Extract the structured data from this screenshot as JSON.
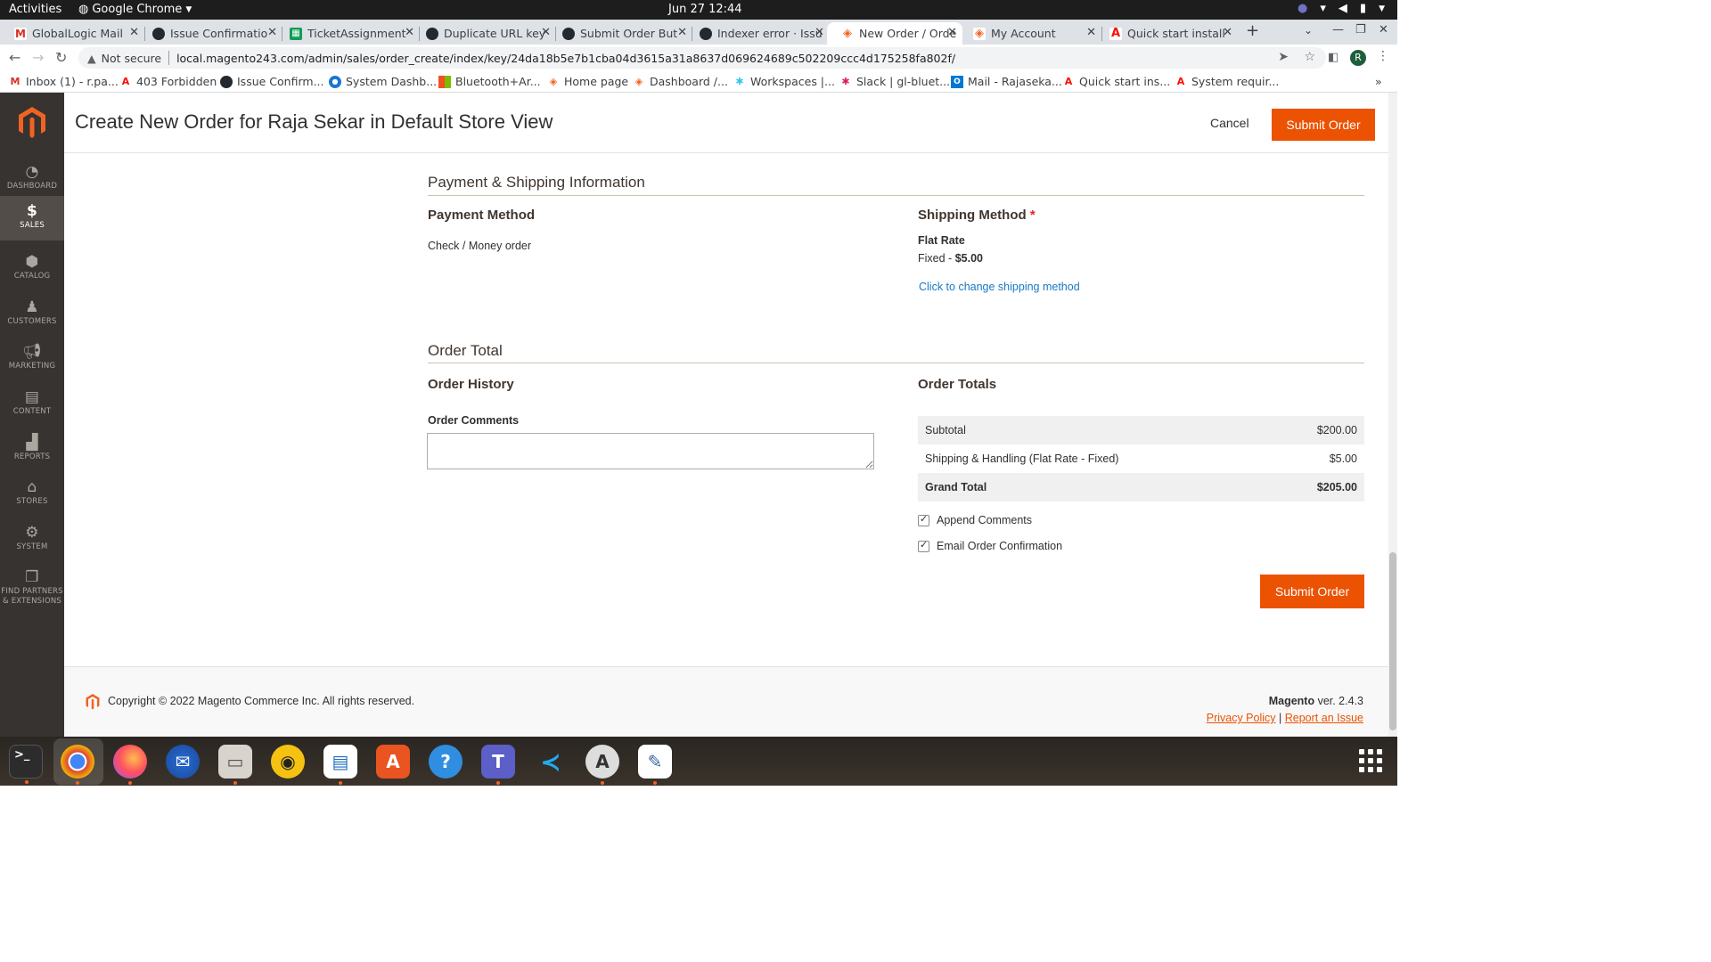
{
  "topbar": {
    "activities": "Activities",
    "app_name": "Google Chrome",
    "clock": "Jun 27  12:44"
  },
  "tabs": [
    {
      "title": "GlobalLogic Mail",
      "favicon": "gmail-icon"
    },
    {
      "title": "Issue Confirmatio",
      "favicon": "github-icon"
    },
    {
      "title": "TicketAssignment",
      "favicon": "sheets-icon"
    },
    {
      "title": "Duplicate URL key",
      "favicon": "github-icon"
    },
    {
      "title": "Submit Order But",
      "favicon": "github-icon"
    },
    {
      "title": "Indexer error · Issu",
      "favicon": "github-icon"
    },
    {
      "title": "New Order / Orde",
      "favicon": "magento-icon",
      "active": true
    },
    {
      "title": "My Account",
      "favicon": "magento-icon"
    },
    {
      "title": "Quick start install",
      "favicon": "adobe-icon"
    }
  ],
  "address_bar": {
    "security": "Not secure",
    "url": "local.magento243.com/admin/sales/order_create/index/key/24da18b5e7b1cba04d3615a31a8637d069624689c502209ccc4d175258fa802f/"
  },
  "profile_initial": "R",
  "bookmarks": [
    {
      "label": "Inbox (1) - r.pa...",
      "icon": "gmail-icon"
    },
    {
      "label": "403 Forbidden",
      "icon": "adobe-icon"
    },
    {
      "label": "Issue Confirm...",
      "icon": "github-icon"
    },
    {
      "label": "System Dashb...",
      "icon": "person-icon"
    },
    {
      "label": "Bluetooth+Ar...",
      "icon": "microsoft-icon"
    },
    {
      "label": "Home page",
      "icon": "magento-icon"
    },
    {
      "label": "Dashboard /...",
      "icon": "magento-icon"
    },
    {
      "label": "Workspaces |...",
      "icon": "slack-icon"
    },
    {
      "label": "Slack | gl-bluet...",
      "icon": "slack-icon"
    },
    {
      "label": "Mail - Rajaseka...",
      "icon": "outlook-icon"
    },
    {
      "label": "Quick start ins...",
      "icon": "adobe-icon"
    },
    {
      "label": "System requir...",
      "icon": "adobe-icon"
    }
  ],
  "sidebar": {
    "items": [
      {
        "label": "DASHBOARD",
        "icon": "dashboard-icon"
      },
      {
        "label": "SALES",
        "icon": "dollar-icon",
        "active": true
      },
      {
        "label": "CATALOG",
        "icon": "box-icon"
      },
      {
        "label": "CUSTOMERS",
        "icon": "person-icon"
      },
      {
        "label": "MARKETING",
        "icon": "megaphone-icon"
      },
      {
        "label": "CONTENT",
        "icon": "layout-icon"
      },
      {
        "label": "REPORTS",
        "icon": "bar-chart-icon"
      },
      {
        "label": "STORES",
        "icon": "store-icon"
      },
      {
        "label": "SYSTEM",
        "icon": "gear-icon"
      },
      {
        "label1": "FIND PARTNERS",
        "label2": "& EXTENSIONS",
        "icon": "cubes-icon"
      }
    ]
  },
  "header": {
    "title": "Create New Order for Raja Sekar in Default Store View",
    "cancel": "Cancel",
    "submit": "Submit Order"
  },
  "payment_shipping": {
    "section_title": "Payment & Shipping Information",
    "payment_heading": "Payment Method",
    "payment_value": "Check / Money order",
    "shipping_heading": "Shipping Method",
    "shipping_required": "*",
    "carrier": "Flat Rate",
    "method_label": "Fixed - ",
    "method_price": "$5.00",
    "change_link": "Click to change shipping method"
  },
  "order_total": {
    "section_title": "Order Total",
    "history_heading": "Order History",
    "comments_label": "Order Comments",
    "comments_value": "",
    "totals_heading": "Order Totals",
    "rows": [
      {
        "label": "Subtotal",
        "value": "$200.00"
      },
      {
        "label": "Shipping & Handling (Flat Rate - Fixed)",
        "value": "$5.00"
      },
      {
        "label": "Grand Total",
        "value": "$205.00"
      }
    ],
    "append_comments": "Append Comments",
    "email_confirmation": "Email Order Confirmation",
    "submit": "Submit Order"
  },
  "footer": {
    "copyright": "Copyright © 2022 Magento Commerce Inc. All rights reserved.",
    "brand": "Magento",
    "version": " ver. 2.4.3",
    "privacy": "Privacy Policy",
    "separator": "|",
    "report": "Report an Issue"
  },
  "dock": [
    {
      "name": "terminal-icon"
    },
    {
      "name": "chrome-icon"
    },
    {
      "name": "firefox-icon"
    },
    {
      "name": "thunderbird-icon"
    },
    {
      "name": "files-icon"
    },
    {
      "name": "rhythmbox-icon"
    },
    {
      "name": "writer-icon"
    },
    {
      "name": "software-icon"
    },
    {
      "name": "help-icon"
    },
    {
      "name": "teams-icon"
    },
    {
      "name": "vscode-icon"
    },
    {
      "name": "updater-icon"
    },
    {
      "name": "text-editor-icon"
    }
  ],
  "colors": {
    "accent": "#eb5202",
    "sidebar": "#373330",
    "link": "#1979c3"
  }
}
